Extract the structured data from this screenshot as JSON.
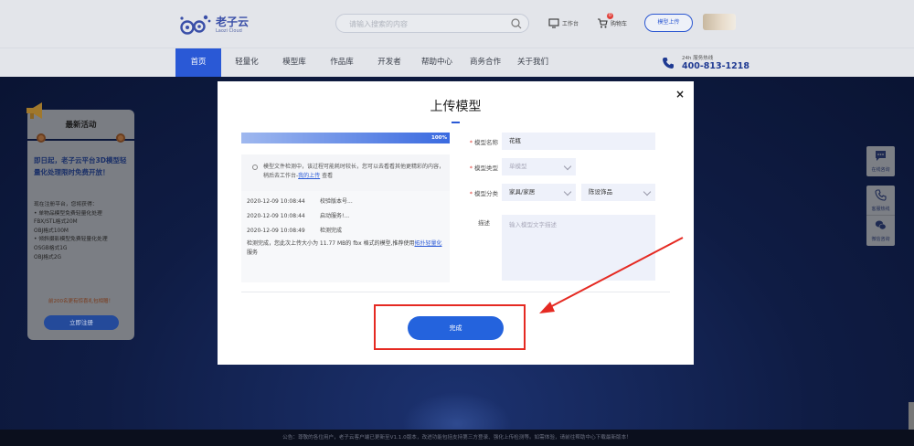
{
  "header": {
    "logo_text": "老子云",
    "logo_sub": "Laozi Cloud",
    "search_placeholder": "请输入搜索的内容",
    "workbench_label": "工作台",
    "cart_label": "购物车",
    "cart_count": "0",
    "upload_button": "模型上传"
  },
  "nav": {
    "items": [
      "首页",
      "轻量化",
      "模型库",
      "作品库",
      "开发者",
      "帮助中心",
      "商务合作",
      "关于我们"
    ],
    "active": "首页",
    "hotline_label": "24h 服务热线",
    "hotline_number": "400-813-1218"
  },
  "promo": {
    "title": "最新活动",
    "headline": "即日起，老子云平台3D模型轻量化处理限时免费开放！",
    "body_lines": [
      "现在注册平台，您将获得：",
      "• 单物品模型免费轻量化处理",
      "FBX/STL格式20M",
      "OBJ格式100M",
      "• 倾斜摄影模型免费轻量化处理",
      "OSGB格式1G",
      "OBJ格式2G"
    ],
    "warn": "前200名更有惊喜礼包相赠！",
    "button": "立即注册"
  },
  "side_tools": {
    "items": [
      {
        "icon": "chat-icon",
        "label": "在线咨询"
      },
      {
        "icon": "phone-icon",
        "label": "客服热线"
      },
      {
        "icon": "wechat-icon",
        "label": "微信咨询"
      }
    ]
  },
  "notice": {
    "text": "公告：尊敬的各位用户，老子云客户端已更新至V1.1.0版本，改进功能包括支持第三方登录、强化上传检测等。如需体验，请前往帮助中心下载最新版本！"
  },
  "modal": {
    "title": "上传模型",
    "close": "×",
    "progress_percent": 100,
    "progress_label": "100%",
    "notice_text": "模型文件检测中，该过程可能耗时较长，您可以去看看其他更精彩的内容，稍后去工作台-",
    "notice_link": "我的上传",
    "notice_tail": "查看",
    "log": [
      {
        "time": "2020-12-09 10:08:44",
        "msg": "校验版本号..."
      },
      {
        "time": "2020-12-09 10:08:44",
        "msg": "启动服务!..."
      },
      {
        "time": "2020-12-09 10:08:49",
        "msg": "检测完成"
      }
    ],
    "result_text": "检测完成，您此次上传大小为 11.77 MB的 fbx 格式的模型,推荐使用",
    "result_link": "拓扑轻量化",
    "result_tail": "服务",
    "form": {
      "name_label": "模型名称",
      "name_value": "花瓶",
      "type_label": "模型类型",
      "type_value": "单模型",
      "category_label": "模型分类",
      "category_value1": "家具/家居",
      "category_value2": "陈设饰品",
      "desc_label": "描述",
      "desc_placeholder": "输入模型文字描述"
    },
    "done_button": "完成"
  }
}
